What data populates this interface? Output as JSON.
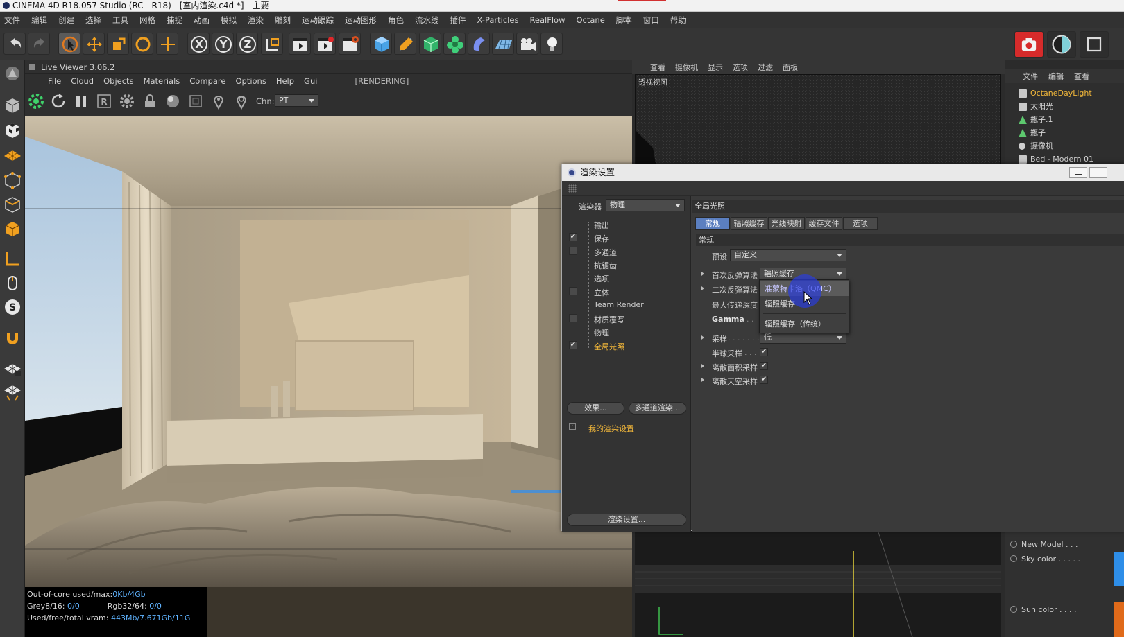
{
  "app": {
    "title": "CINEMA 4D R18.057 Studio (RC - R18) - [室内渲染.c4d *] - 主要"
  },
  "menubar": [
    "文件",
    "编辑",
    "创建",
    "选择",
    "工具",
    "网格",
    "捕捉",
    "动画",
    "模拟",
    "渲染",
    "雕刻",
    "运动跟踪",
    "运动图形",
    "角色",
    "流水线",
    "插件",
    "X-Particles",
    "RealFlow",
    "Octane",
    "脚本",
    "窗口",
    "帮助"
  ],
  "toolbar": {
    "axis_x": "X",
    "axis_y": "Y",
    "axis_z": "Z"
  },
  "live_viewer": {
    "title": "Live Viewer 3.06.2",
    "menu": [
      "File",
      "Cloud",
      "Objects",
      "Materials",
      "Compare",
      "Options",
      "Help",
      "Gui"
    ],
    "status": "[RENDERING]",
    "channel_label": "Chn:",
    "channel_value": "PT",
    "stats": {
      "outofcore_label": "Out-of-core used/max:",
      "outofcore_value": "0Kb/4Gb",
      "grey_label": "Grey8/16:",
      "grey_value": "0/0",
      "rgb_label": "Rgb32/64:",
      "rgb_value": "0/0",
      "vram_label": "Used/free/total vram:",
      "vram_value": "443Mb/7.671Gb/11G"
    }
  },
  "viewport": {
    "menu": [
      "查看",
      "摄像机",
      "显示",
      "选项",
      "过滤",
      "面板"
    ],
    "label": "透视视图"
  },
  "object_manager": {
    "menu": [
      "文件",
      "编辑",
      "查看"
    ],
    "items": [
      {
        "label": "OctaneDayLight",
        "highlight": true
      },
      {
        "label": "太阳光",
        "highlight": false
      },
      {
        "label": "瓶子.1",
        "highlight": false
      },
      {
        "label": "瓶子",
        "highlight": false
      },
      {
        "label": "摄像机",
        "highlight": false
      },
      {
        "label": "Bed - Modern 01",
        "highlight": false
      }
    ]
  },
  "attributes": {
    "new_model": "New Model . . .",
    "sky_color": "Sky color . . . . .",
    "sun_color": "Sun color . . . ."
  },
  "dialog": {
    "title": "渲染设置",
    "renderer_label": "渲染器",
    "renderer_value": "物理",
    "nav": [
      {
        "label": "输出",
        "check": "none"
      },
      {
        "label": "保存",
        "check": "checked"
      },
      {
        "label": "多通道",
        "check": "empty"
      },
      {
        "label": "抗锯齿",
        "check": "none"
      },
      {
        "label": "选项",
        "check": "none"
      },
      {
        "label": "立体",
        "check": "empty"
      },
      {
        "label": "Team Render",
        "check": "none"
      },
      {
        "label": "材质覆写",
        "check": "empty"
      },
      {
        "label": "物理",
        "check": "none"
      },
      {
        "label": "全局光照",
        "check": "checked",
        "active": true
      }
    ],
    "effects_button": "效果...",
    "multipass_button": "多通道渲染...",
    "my_settings": "我的渲染设置",
    "render_settings_button": "渲染设置...",
    "section_title": "全局光照",
    "tabs": [
      "常规",
      "辐照缓存",
      "光线映射",
      "缓存文件",
      "选项"
    ],
    "active_tab": 0,
    "group_title": "常规",
    "preset_label": "预设",
    "preset_value": "自定义",
    "primary_label": "首次反弹算法",
    "primary_value": "辐照缓存",
    "secondary_label": "二次反弹算法",
    "depth_label": "最大传递深度",
    "gamma_label": "Gamma",
    "sampling_label": "采样",
    "sampling_value": "低",
    "hemisphere_label": "半球采样",
    "area_label": "离散面积采样",
    "sky_label": "离散天空采样",
    "dropdown_options": [
      "准蒙特卡洛（QMC）",
      "辐照缓存",
      "辐照缓存（传统）"
    ],
    "dropdown_hover": 0
  },
  "colors": {
    "accent_blue": "#5b7fc0",
    "active_orange": "#f0b63a",
    "record_red": "#e0282a",
    "vram_blue": "#5fb3ff"
  }
}
